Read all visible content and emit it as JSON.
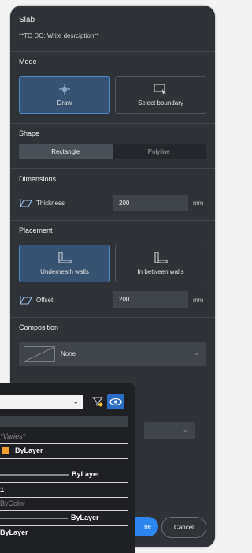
{
  "panel": {
    "title": "Slab",
    "description": "**TO DO: Write desrciption**",
    "mode": {
      "label": "Mode",
      "options": [
        "Draw",
        "Select boundary"
      ],
      "selected": "Draw"
    },
    "shape": {
      "label": "Shape",
      "options": [
        "Rectangle",
        "Polyline"
      ],
      "selected": "Rectangle"
    },
    "dimensions": {
      "label": "Dimensions",
      "thickness_label": "Thickness",
      "thickness_value": "200",
      "unit": "mm"
    },
    "placement": {
      "label": "Placement",
      "options": [
        "Underneath walls",
        "In between walls"
      ],
      "selected": "Underneath walls",
      "offset_label": "Offset",
      "offset_value": "200",
      "unit": "mm"
    },
    "composition": {
      "label": "Composition",
      "value": "None"
    },
    "buttons": {
      "done": "ne",
      "cancel": "Cancel"
    }
  },
  "properties_popup": {
    "varies": "*Varies*",
    "color": "ByLayer",
    "linetype": "ByLayer",
    "scale": "1",
    "plotstyle": "ByColor",
    "lineweight": "ByLayer",
    "transparency": "ByLayer"
  },
  "colors": {
    "panel_bg": "#2f3338",
    "accent_blue": "#2b86f0",
    "selected_card": "#385273",
    "swatch_orange": "#f0a030"
  }
}
